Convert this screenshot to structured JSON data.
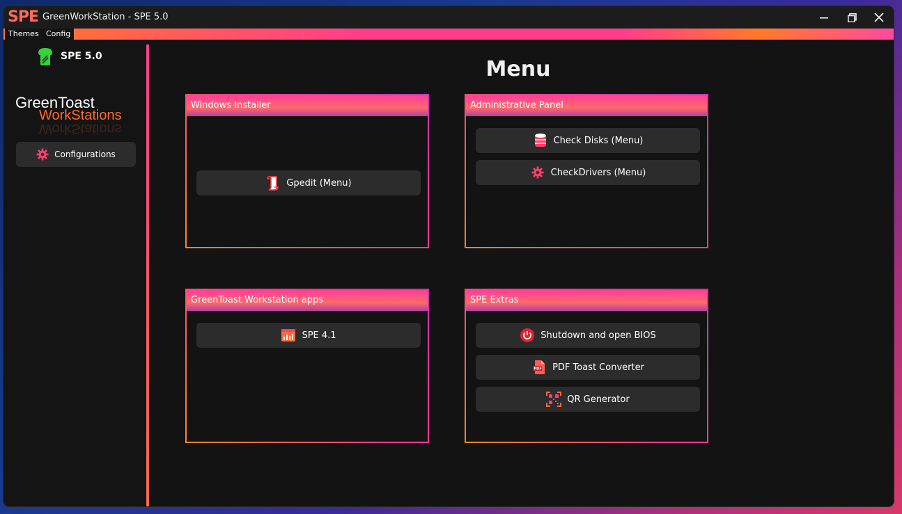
{
  "window": {
    "logo": "SPE",
    "title": "GreenWorkStation - SPE 5.0",
    "controls": {
      "minimize": "—",
      "restore": "⧉",
      "close": "✕"
    }
  },
  "menubar": {
    "items": [
      "Themes",
      "Config"
    ]
  },
  "sidebar": {
    "version": "SPE 5.0",
    "brand_line1": "GreenToast",
    "brand_line2": "WorkStations",
    "configurations_label": "Configurations"
  },
  "main": {
    "title": "Menu",
    "panels": [
      {
        "header": "Windows Installer",
        "buttons": [
          {
            "label": "Gpedit (Menu)",
            "icon": "scroll-icon"
          }
        ]
      },
      {
        "header": "Administrative Panel",
        "buttons": [
          {
            "label": "Check Disks (Menu)",
            "icon": "disk-icon"
          },
          {
            "label": "CheckDrivers (Menu)",
            "icon": "gear-icon"
          }
        ]
      },
      {
        "header": "GreenToast Workstation apps",
        "buttons": [
          {
            "label": "SPE 4.1",
            "icon": "app-window-icon"
          }
        ]
      },
      {
        "header": "SPE Extras",
        "buttons": [
          {
            "label": "Shutdown and open BIOS",
            "icon": "power-icon"
          },
          {
            "label": "PDF Toast Converter",
            "icon": "pdf-icon"
          },
          {
            "label": "QR Generator",
            "icon": "qr-icon"
          }
        ]
      }
    ]
  },
  "colors": {
    "accent_pink": "#ff3e8a",
    "accent_orange": "#ff8a1a",
    "background": "#131313",
    "button": "#2c2c2c"
  }
}
